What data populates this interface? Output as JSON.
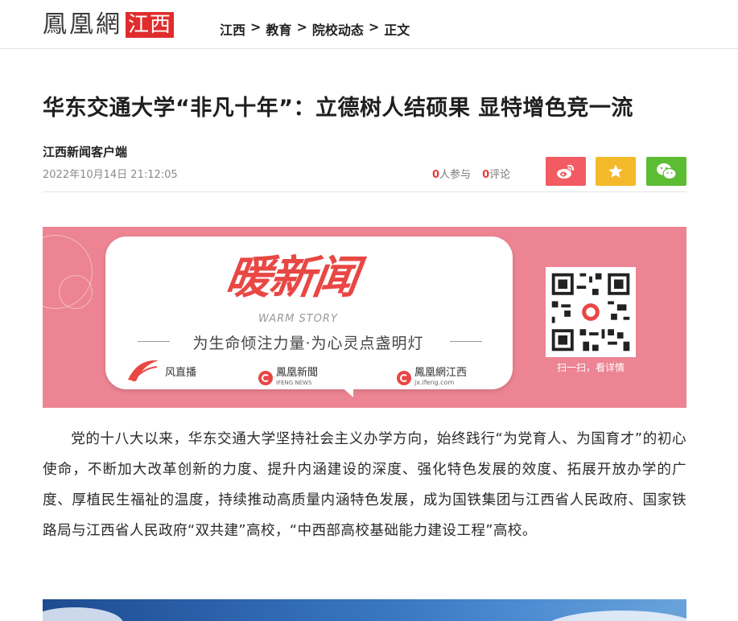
{
  "header": {
    "logo_main": "鳳凰網",
    "logo_sub": "江西",
    "breadcrumb": [
      "江西",
      "教育",
      "院校动态",
      "正文"
    ],
    "breadcrumb_separator": ">"
  },
  "article": {
    "title": "华东交通大学“非凡十年”：立德树人结硕果 显特增色竞一流",
    "source": "江西新闻客户端",
    "timestamp": "2022年10月14日 21:12:05",
    "participants_count": "0",
    "participants_label": "人参与",
    "comments_count": "0",
    "comments_label": "评论",
    "share_buttons": [
      {
        "name": "weibo",
        "icon": "weibo-icon",
        "color": "#f25b62"
      },
      {
        "name": "favorite",
        "icon": "star-icon",
        "color": "#f4b92b"
      },
      {
        "name": "wechat",
        "icon": "wechat-icon",
        "color": "#5cbc33"
      }
    ],
    "paragraph": "党的十八大以来，华东交通大学坚持社会主义办学方向，始终践行“为党育人、为国育才”的初心使命，不断加大改革创新的力度、提升内涵建设的深度、强化特色发展的效度、拓展开放办学的广度、厚植民生福祉的温度，持续推动高质量内涵特色发展，成为国铁集团与江西省人民政府、国家铁路局与江西省人民政府“双共建”高校，“中西部高校基础能力建设工程”高校。"
  },
  "banner": {
    "brand": "暖新闻",
    "brand_en": "WARM STORY",
    "slogan": "为生命倾注力量·为心灵点盏明灯",
    "partners": [
      "风直播",
      "鳳凰新聞",
      "IFENG NEWS",
      "鳳凰網江西",
      "jx.ifeng.com"
    ],
    "qr_caption": "扫一扫，看详情",
    "background_color": "#ec8493"
  },
  "colors": {
    "accent_red": "#e02c2c",
    "count_red": "#e53c3c"
  }
}
